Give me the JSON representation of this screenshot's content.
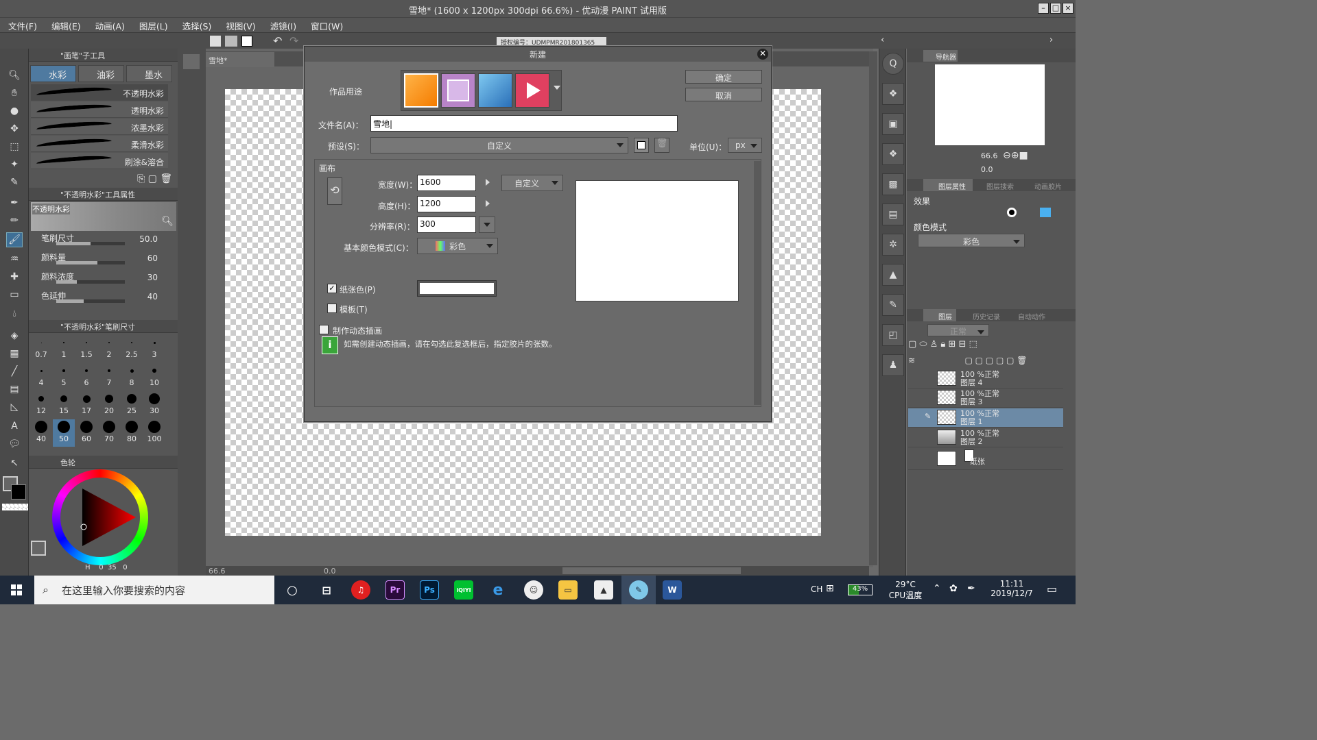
{
  "window": {
    "title": "雪地* (1600 x 1200px 300dpi 66.6%) - 优动漫 PAINT 试用版"
  },
  "menu": [
    "文件(F)",
    "编辑(E)",
    "动画(A)",
    "图层(L)",
    "选择(S)",
    "视图(V)",
    "滤镜(I)",
    "窗口(W)"
  ],
  "license": "授权编号：UDMPMR201801365",
  "subtool": {
    "header": "\"画笔\"子工具",
    "tabs": [
      "水彩",
      "油彩",
      "墨水"
    ],
    "brushes": [
      "不透明水彩",
      "透明水彩",
      "浓墨水彩",
      "柔滑水彩",
      "刷涂&溶合"
    ],
    "props_header": "\"不透明水彩\"工具属性",
    "preview_label": "不透明水彩",
    "props": [
      {
        "label": "笔刷尺寸",
        "value": "50.0",
        "level": 0.5
      },
      {
        "label": "颜料量",
        "value": "60",
        "level": 0.6
      },
      {
        "label": "颜料浓度",
        "value": "30",
        "level": 0.3
      },
      {
        "label": "色延伸",
        "value": "40",
        "level": 0.4
      }
    ],
    "size_header": "\"不透明水彩\"笔刷尺寸",
    "sizes": [
      "0.7",
      "1",
      "1.5",
      "2",
      "2.5",
      "3",
      "4",
      "5",
      "6",
      "7",
      "8",
      "10",
      "12",
      "15",
      "17",
      "20",
      "25",
      "30",
      "40",
      "50",
      "60",
      "70",
      "80",
      "100"
    ],
    "selected_size": "50",
    "color_tab": "色轮",
    "color_values": {
      "h": "H",
      "s": "0",
      "l": "35",
      "v": "0"
    }
  },
  "document": {
    "tab": "雪地*",
    "zoom": "66.6",
    "angle": "0.0"
  },
  "dialog": {
    "title": "新建",
    "ok": "确定",
    "cancel": "取消",
    "purpose_label": "作品用途",
    "filename_label": "文件名(A)：",
    "filename_value": "雪地",
    "preset_label": "预设(S)：",
    "preset_value": "自定义",
    "unit_label": "单位(U)：",
    "unit_value": "px",
    "canvas_label": "画布",
    "width_label": "宽度(W)：",
    "width_value": "1600",
    "size_preset": "自定义",
    "height_label": "高度(H)：",
    "height_value": "1200",
    "resolution_label": "分辨率(R)：",
    "resolution_value": "300",
    "color_mode_label": "基本颜色模式(C)：",
    "color_mode_value": "彩色",
    "paper_color_label": "纸张色(P)",
    "paper_color_checked": true,
    "template_label": "模板(T)",
    "anim_label": "制作动态插画",
    "anim_info": "如需创建动态插画，请在勾选此复选框后，指定胶片的张数。"
  },
  "right_panel": {
    "nav_tab": "导航器",
    "nav_zoom": "66.6",
    "nav_angle": "0.0",
    "props_tabs": [
      "图层属性",
      "图层搜索",
      "动画胶片"
    ],
    "effect_label": "效果",
    "color_mode_label": "颜色模式",
    "color_mode_value": "彩色",
    "layer_tabs": [
      "图层",
      "历史记录",
      "自动动作"
    ],
    "blend_mode": "正常",
    "layers": [
      {
        "opacity": "100 %正常",
        "name": "图层 4",
        "selected": false
      },
      {
        "opacity": "100 %正常",
        "name": "图层 3",
        "selected": false
      },
      {
        "opacity": "100 %正常",
        "name": "图层 1",
        "selected": true
      },
      {
        "opacity": "100 %正常",
        "name": "图层 2",
        "selected": false
      },
      {
        "opacity": "",
        "name": "纸张",
        "selected": false
      }
    ]
  },
  "taskbar": {
    "search_placeholder": "在这里输入你要搜索的内容",
    "apps": [
      "Pr",
      "Ps",
      "iQIYI",
      "W"
    ],
    "input_lang": "CH",
    "battery": "43%",
    "temp": "29°C",
    "temp_label": "CPU温度",
    "time": "11:11",
    "date": "2019/12/7"
  },
  "colors": {
    "accent": "#4f7aa0",
    "selected_layer": "#6c8aa6",
    "taskbar": "#1f2a3a"
  }
}
